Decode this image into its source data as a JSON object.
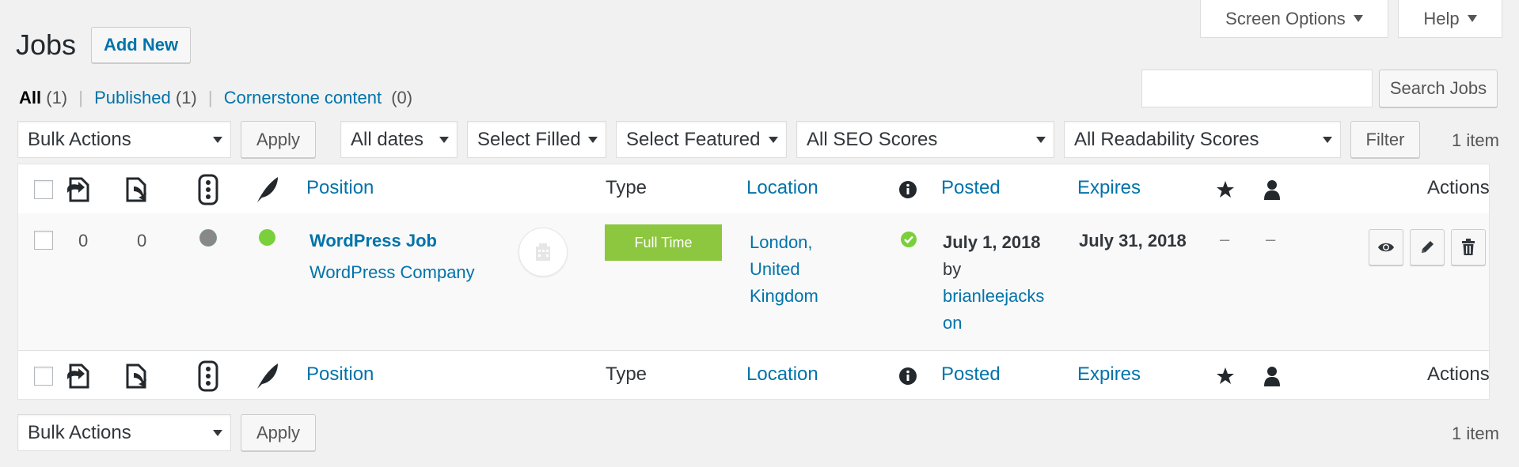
{
  "header": {
    "title": "Jobs",
    "add_new": "Add New"
  },
  "screen_options": {
    "label": "Screen Options",
    "help": "Help"
  },
  "views": {
    "all": "All",
    "all_count": "(1)",
    "published": "Published",
    "published_count": "(1)",
    "cornerstone": "Cornerstone content",
    "cornerstone_count": "(0)",
    "sep": "|"
  },
  "search": {
    "placeholder": "",
    "button": "Search Jobs"
  },
  "filters": {
    "bulk_actions": "Bulk Actions",
    "apply": "Apply",
    "dates": "All dates",
    "filled": "Select Filled",
    "featured": "Select Featured",
    "seo": "All SEO Scores",
    "readability": "All Readability Scores",
    "filter": "Filter",
    "count": "1 item"
  },
  "columns": {
    "position": "Position",
    "type": "Type",
    "location": "Location",
    "posted": "Posted",
    "expires": "Expires",
    "actions": "Actions"
  },
  "row": {
    "links_out": "0",
    "links_in": "0",
    "title": "WordPress Job",
    "company": "WordPress Company",
    "type": "Full Time",
    "type_color": "#8dc63f",
    "location_1": "London,",
    "location_2": "United",
    "location_3": "Kingdom",
    "posted_date": "July 1, 2018",
    "posted_by": "by",
    "author_1": "brianleejacks",
    "author_2": "on",
    "expires": "July 31, 2018",
    "featured": "–",
    "filled": "–"
  },
  "colors": {
    "accent": "#0073aa",
    "seo_dot": "#7ad03a",
    "readability_dot": "#888888",
    "status_check": "#7ad03a"
  },
  "bottom": {
    "bulk_actions": "Bulk Actions",
    "apply": "Apply",
    "count": "1 item"
  }
}
